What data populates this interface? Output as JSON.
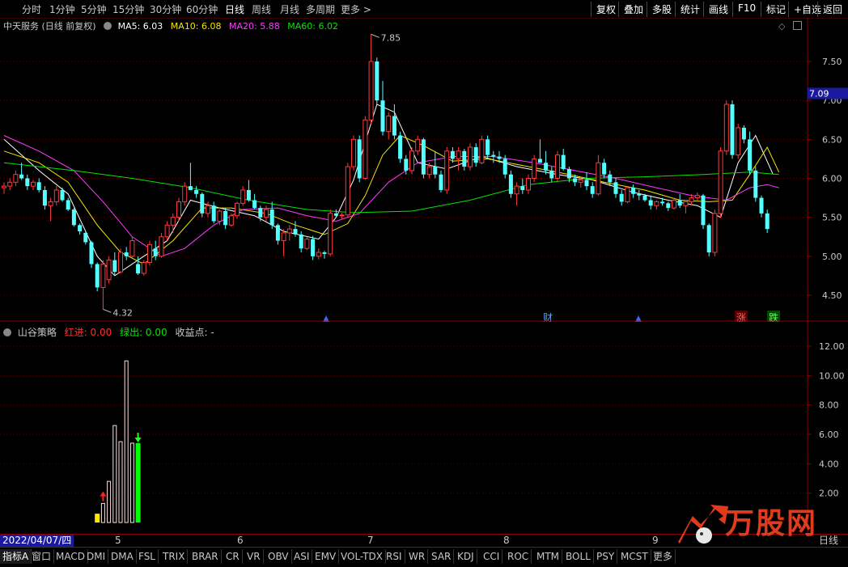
{
  "toolbar": {
    "periods": [
      "分时",
      "1分钟",
      "5分钟",
      "15分钟",
      "30分钟",
      "60分钟",
      "日线",
      "周线",
      "月线",
      "多周期",
      "更多 >"
    ],
    "active_period": "日线",
    "right_buttons": [
      "复权",
      "叠加",
      "多股",
      "统计",
      "画线",
      "F10",
      "标记",
      "+自选",
      "返回"
    ]
  },
  "main_header": {
    "stock_label": "中天服务 (日线 前复权)",
    "ma5": "MA5: 6.03",
    "ma10": "MA10: 6.08",
    "ma20": "MA20: 5.88",
    "ma60": "MA60: 6.02",
    "colors": {
      "ma5": "#ffffff",
      "ma10": "#f5e600",
      "ma20": "#ff3bff",
      "ma60": "#00e600"
    }
  },
  "price_axis": {
    "ticks": [
      "7.50",
      "7.00",
      "6.50",
      "6.00",
      "5.50",
      "5.00",
      "4.50"
    ],
    "current_price": "7.09",
    "high_label": "7.85",
    "low_label": "4.32"
  },
  "event_marks": {
    "finance": "财",
    "up": "涨",
    "down": "跌"
  },
  "sub_header": {
    "indicator_name": "山谷策略",
    "red_in": "红进: 0.00",
    "green_out": "绿出: 0.00",
    "profit_point": "收益点: -"
  },
  "sub_axis": {
    "ticks": [
      "12.00",
      "10.00",
      "8.00",
      "6.00",
      "4.00",
      "2.00"
    ]
  },
  "date_bar": {
    "current_date": "2022/04/07/四",
    "months": [
      "5",
      "6",
      "7",
      "8",
      "9"
    ],
    "right_label": "日线"
  },
  "tabs": [
    "指标A",
    "窗口",
    "MACD",
    "DMI",
    "DMA",
    "FSL",
    "TRIX",
    "BRAR",
    "CR",
    "VR",
    "OBV",
    "ASI",
    "EMV",
    "VOL-TDX",
    "RSI",
    "WR",
    "SAR",
    "KDJ",
    "CCI",
    "ROC",
    "MTM",
    "BOLL",
    "PSY",
    "MCST",
    "更多"
  ],
  "watermark": "万股网",
  "chart_data": {
    "type": "candlestick",
    "price_range": [
      4.2,
      8.0
    ],
    "candles": [
      [
        5.88,
        5.95,
        5.8,
        5.9
      ],
      [
        5.9,
        6.0,
        5.85,
        5.95
      ],
      [
        5.95,
        6.1,
        5.9,
        6.05
      ],
      [
        6.05,
        6.2,
        5.98,
        6.0
      ],
      [
        6.0,
        6.05,
        5.85,
        5.9
      ],
      [
        5.9,
        5.98,
        5.85,
        5.95
      ],
      [
        5.95,
        6.0,
        5.82,
        5.85
      ],
      [
        5.85,
        5.9,
        5.6,
        5.65
      ],
      [
        5.65,
        5.75,
        5.45,
        5.7
      ],
      [
        5.7,
        5.9,
        5.65,
        5.85
      ],
      [
        5.85,
        5.88,
        5.7,
        5.72
      ],
      [
        5.72,
        5.75,
        5.58,
        5.6
      ],
      [
        5.6,
        5.62,
        5.38,
        5.4
      ],
      [
        5.4,
        5.42,
        5.28,
        5.32
      ],
      [
        5.3,
        5.32,
        5.15,
        5.18
      ],
      [
        5.18,
        5.2,
        4.85,
        4.9
      ],
      [
        4.9,
        4.92,
        4.55,
        4.6
      ],
      [
        4.6,
        4.95,
        4.32,
        4.9
      ],
      [
        4.7,
        5.0,
        4.65,
        4.95
      ],
      [
        4.95,
        5.05,
        4.75,
        4.8
      ],
      [
        4.8,
        5.1,
        4.78,
        5.05
      ],
      [
        5.05,
        5.12,
        4.95,
        5.0
      ],
      [
        5.0,
        5.25,
        4.98,
        5.2
      ],
      [
        4.9,
        5.0,
        4.76,
        4.78
      ],
      [
        4.78,
        4.95,
        4.75,
        4.92
      ],
      [
        4.92,
        5.2,
        4.88,
        5.15
      ],
      [
        5.1,
        5.2,
        4.95,
        5.0
      ],
      [
        5.0,
        5.3,
        4.98,
        5.25
      ],
      [
        5.25,
        5.45,
        5.2,
        5.4
      ],
      [
        5.4,
        5.55,
        5.3,
        5.5
      ],
      [
        5.5,
        5.75,
        5.45,
        5.7
      ],
      [
        5.7,
        5.95,
        5.65,
        5.9
      ],
      [
        5.9,
        6.2,
        5.85,
        5.85
      ],
      [
        5.85,
        5.9,
        5.75,
        5.8
      ],
      [
        5.8,
        5.82,
        5.5,
        5.55
      ],
      [
        5.55,
        5.7,
        5.5,
        5.65
      ],
      [
        5.65,
        5.7,
        5.42,
        5.45
      ],
      [
        5.45,
        5.6,
        5.4,
        5.58
      ],
      [
        5.58,
        5.62,
        5.35,
        5.4
      ],
      [
        5.4,
        5.55,
        5.38,
        5.52
      ],
      [
        5.52,
        5.7,
        5.48,
        5.68
      ],
      [
        5.68,
        5.9,
        5.65,
        5.85
      ],
      [
        5.85,
        5.98,
        5.7,
        5.72
      ],
      [
        5.72,
        5.8,
        5.6,
        5.62
      ],
      [
        5.62,
        5.65,
        5.45,
        5.5
      ],
      [
        5.5,
        5.65,
        5.45,
        5.6
      ],
      [
        5.6,
        5.7,
        5.35,
        5.4
      ],
      [
        5.4,
        5.42,
        5.15,
        5.2
      ],
      [
        5.2,
        5.35,
        5.0,
        5.3
      ],
      [
        5.3,
        5.4,
        5.2,
        5.35
      ],
      [
        5.35,
        5.45,
        5.25,
        5.28
      ],
      [
        5.28,
        5.32,
        5.05,
        5.1
      ],
      [
        5.1,
        5.25,
        5.08,
        5.22
      ],
      [
        5.22,
        5.26,
        4.95,
        5.0
      ],
      [
        5.0,
        5.1,
        4.96,
        5.05
      ],
      [
        5.05,
        5.07,
        4.97,
        5.03
      ],
      [
        5.03,
        5.6,
        5.0,
        5.55
      ],
      [
        5.55,
        5.6,
        5.5,
        5.52
      ],
      [
        5.52,
        5.56,
        5.48,
        5.53
      ],
      [
        5.53,
        6.2,
        5.5,
        6.15
      ],
      [
        6.15,
        6.55,
        6.1,
        6.5
      ],
      [
        6.5,
        6.55,
        5.95,
        6.0
      ],
      [
        6.0,
        6.8,
        5.98,
        6.75
      ],
      [
        6.75,
        7.85,
        6.7,
        7.5
      ],
      [
        7.5,
        7.55,
        6.95,
        7.0
      ],
      [
        7.0,
        7.25,
        6.55,
        6.6
      ],
      [
        6.6,
        6.85,
        6.5,
        6.8
      ],
      [
        6.8,
        6.95,
        6.5,
        6.55
      ],
      [
        6.55,
        6.6,
        6.2,
        6.25
      ],
      [
        6.25,
        6.3,
        6.05,
        6.1
      ],
      [
        6.1,
        6.4,
        6.05,
        6.35
      ],
      [
        6.35,
        6.55,
        6.3,
        6.5
      ],
      [
        6.5,
        6.52,
        6.0,
        6.05
      ],
      [
        6.05,
        6.2,
        6.0,
        6.15
      ],
      [
        6.15,
        6.35,
        6.0,
        6.05
      ],
      [
        6.05,
        6.1,
        5.82,
        5.85
      ],
      [
        5.85,
        6.4,
        5.8,
        6.35
      ],
      [
        6.35,
        6.4,
        6.2,
        6.25
      ],
      [
        6.25,
        6.4,
        6.1,
        6.35
      ],
      [
        6.35,
        6.38,
        6.1,
        6.15
      ],
      [
        6.15,
        6.45,
        6.1,
        6.4
      ],
      [
        6.4,
        6.45,
        6.15,
        6.2
      ],
      [
        6.2,
        6.55,
        6.18,
        6.5
      ],
      [
        6.5,
        6.55,
        6.25,
        6.3
      ],
      [
        6.3,
        6.35,
        6.2,
        6.28
      ],
      [
        6.28,
        6.35,
        6.2,
        6.25
      ],
      [
        6.25,
        6.3,
        6.0,
        6.05
      ],
      [
        6.05,
        6.1,
        5.75,
        5.8
      ],
      [
        5.8,
        5.95,
        5.65,
        5.9
      ],
      [
        5.9,
        6.0,
        5.8,
        5.85
      ],
      [
        5.85,
        6.05,
        5.8,
        6.0
      ],
      [
        6.0,
        6.3,
        5.95,
        6.25
      ],
      [
        6.25,
        6.5,
        6.2,
        6.2
      ],
      [
        6.2,
        6.35,
        6.05,
        6.1
      ],
      [
        6.1,
        6.15,
        5.95,
        6.0
      ],
      [
        6.0,
        6.35,
        5.95,
        6.3
      ],
      [
        6.3,
        6.38,
        6.1,
        6.12
      ],
      [
        6.12,
        6.15,
        5.95,
        6.0
      ],
      [
        6.0,
        6.05,
        5.9,
        5.95
      ],
      [
        5.95,
        6.02,
        5.88,
        5.98
      ],
      [
        5.98,
        6.08,
        5.85,
        5.9
      ],
      [
        5.9,
        5.95,
        5.75,
        5.8
      ],
      [
        5.8,
        6.3,
        5.78,
        6.2
      ],
      [
        6.2,
        6.25,
        6.0,
        6.05
      ],
      [
        6.05,
        6.1,
        5.9,
        5.95
      ],
      [
        5.95,
        6.0,
        5.75,
        5.8
      ],
      [
        5.8,
        5.85,
        5.65,
        5.7
      ],
      [
        5.7,
        5.9,
        5.68,
        5.88
      ],
      [
        5.88,
        5.92,
        5.75,
        5.8
      ],
      [
        5.8,
        5.85,
        5.72,
        5.78
      ],
      [
        5.78,
        5.8,
        5.7,
        5.72
      ],
      [
        5.72,
        5.78,
        5.6,
        5.65
      ],
      [
        5.65,
        5.72,
        5.6,
        5.7
      ],
      [
        5.7,
        5.75,
        5.65,
        5.68
      ],
      [
        5.68,
        5.7,
        5.58,
        5.62
      ],
      [
        5.62,
        5.75,
        5.6,
        5.72
      ],
      [
        5.72,
        5.8,
        5.62,
        5.65
      ],
      [
        5.65,
        5.72,
        5.55,
        5.7
      ],
      [
        5.7,
        5.8,
        5.65,
        5.75
      ],
      [
        5.75,
        5.82,
        5.7,
        5.78
      ],
      [
        5.78,
        5.8,
        5.35,
        5.4
      ],
      [
        5.4,
        5.42,
        5.0,
        5.05
      ],
      [
        5.05,
        5.6,
        5.0,
        5.55
      ],
      [
        5.55,
        6.4,
        5.5,
        6.35
      ],
      [
        6.35,
        7.0,
        6.3,
        6.95
      ],
      [
        6.95,
        7.0,
        6.25,
        6.3
      ],
      [
        6.3,
        6.7,
        6.25,
        6.65
      ],
      [
        6.65,
        6.68,
        6.45,
        6.5
      ],
      [
        6.5,
        6.6,
        6.05,
        6.1
      ],
      [
        6.1,
        6.15,
        5.7,
        5.75
      ],
      [
        5.75,
        5.78,
        5.5,
        5.55
      ],
      [
        5.55,
        5.6,
        5.3,
        5.35
      ]
    ],
    "ma_series": [
      {
        "name": "MA5",
        "points": [
          [
            0,
            6.5
          ],
          [
            6,
            6.1
          ],
          [
            11,
            5.8
          ],
          [
            16,
            5.0
          ],
          [
            19,
            4.75
          ],
          [
            23,
            4.95
          ],
          [
            28,
            5.2
          ],
          [
            32,
            5.72
          ],
          [
            37,
            5.62
          ],
          [
            43,
            5.52
          ],
          [
            48,
            5.32
          ],
          [
            54,
            5.22
          ],
          [
            57,
            5.5
          ],
          [
            60,
            5.98
          ],
          [
            64,
            6.95
          ],
          [
            67,
            6.85
          ],
          [
            71,
            6.2
          ],
          [
            76,
            6.12
          ],
          [
            82,
            6.28
          ],
          [
            88,
            6.15
          ],
          [
            95,
            6.05
          ],
          [
            101,
            5.98
          ],
          [
            108,
            5.82
          ],
          [
            114,
            5.72
          ],
          [
            119,
            5.65
          ],
          [
            123,
            5.5
          ],
          [
            126,
            6.2
          ],
          [
            129,
            6.55
          ],
          [
            132,
            6.05
          ]
        ]
      },
      {
        "name": "MA10",
        "points": [
          [
            0,
            6.35
          ],
          [
            6,
            6.2
          ],
          [
            11,
            5.95
          ],
          [
            16,
            5.4
          ],
          [
            20,
            5.05
          ],
          [
            24,
            4.9
          ],
          [
            29,
            5.2
          ],
          [
            34,
            5.62
          ],
          [
            39,
            5.62
          ],
          [
            45,
            5.55
          ],
          [
            50,
            5.4
          ],
          [
            55,
            5.28
          ],
          [
            59,
            5.42
          ],
          [
            62,
            5.78
          ],
          [
            65,
            6.3
          ],
          [
            68,
            6.55
          ],
          [
            72,
            6.42
          ],
          [
            77,
            6.22
          ],
          [
            83,
            6.25
          ],
          [
            90,
            6.15
          ],
          [
            97,
            6.05
          ],
          [
            103,
            5.95
          ],
          [
            110,
            5.85
          ],
          [
            116,
            5.72
          ],
          [
            121,
            5.7
          ],
          [
            125,
            5.72
          ],
          [
            128,
            6.05
          ],
          [
            131,
            6.4
          ],
          [
            133,
            6.08
          ]
        ]
      },
      {
        "name": "MA20",
        "points": [
          [
            0,
            6.55
          ],
          [
            6,
            6.35
          ],
          [
            12,
            6.1
          ],
          [
            17,
            5.7
          ],
          [
            22,
            5.25
          ],
          [
            27,
            5.0
          ],
          [
            31,
            5.1
          ],
          [
            36,
            5.4
          ],
          [
            41,
            5.6
          ],
          [
            47,
            5.62
          ],
          [
            52,
            5.52
          ],
          [
            57,
            5.45
          ],
          [
            61,
            5.55
          ],
          [
            66,
            5.95
          ],
          [
            71,
            6.2
          ],
          [
            77,
            6.28
          ],
          [
            84,
            6.28
          ],
          [
            91,
            6.2
          ],
          [
            98,
            6.1
          ],
          [
            105,
            6.0
          ],
          [
            112,
            5.88
          ],
          [
            118,
            5.78
          ],
          [
            124,
            5.72
          ],
          [
            128,
            5.88
          ],
          [
            131,
            5.92
          ],
          [
            133,
            5.88
          ]
        ]
      },
      {
        "name": "MA60",
        "points": [
          [
            0,
            6.2
          ],
          [
            12,
            6.1
          ],
          [
            22,
            6.0
          ],
          [
            32,
            5.88
          ],
          [
            42,
            5.72
          ],
          [
            52,
            5.6
          ],
          [
            60,
            5.56
          ],
          [
            70,
            5.58
          ],
          [
            80,
            5.72
          ],
          [
            90,
            5.92
          ],
          [
            100,
            6.0
          ],
          [
            110,
            6.02
          ],
          [
            120,
            6.05
          ],
          [
            128,
            6.08
          ],
          [
            133,
            6.05
          ]
        ]
      }
    ],
    "sub_range": [
      0,
      13
    ],
    "sub_bars": [
      {
        "index": 16,
        "value": 0.6,
        "kind": "yellow"
      },
      {
        "index": 17,
        "value": 1.3,
        "kind": "white"
      },
      {
        "index": 18,
        "value": 2.8,
        "kind": "white"
      },
      {
        "index": 19,
        "value": 6.6,
        "kind": "white"
      },
      {
        "index": 20,
        "value": 5.5,
        "kind": "white"
      },
      {
        "index": 21,
        "value": 11.0,
        "kind": "white"
      },
      {
        "index": 22,
        "value": 5.4,
        "kind": "white"
      },
      {
        "index": 23,
        "value": 5.4,
        "kind": "green"
      }
    ],
    "signals": [
      {
        "index": 17,
        "type": "buy",
        "value": 2.0
      },
      {
        "index": 23,
        "type": "sell",
        "value": 6.0
      }
    ]
  }
}
